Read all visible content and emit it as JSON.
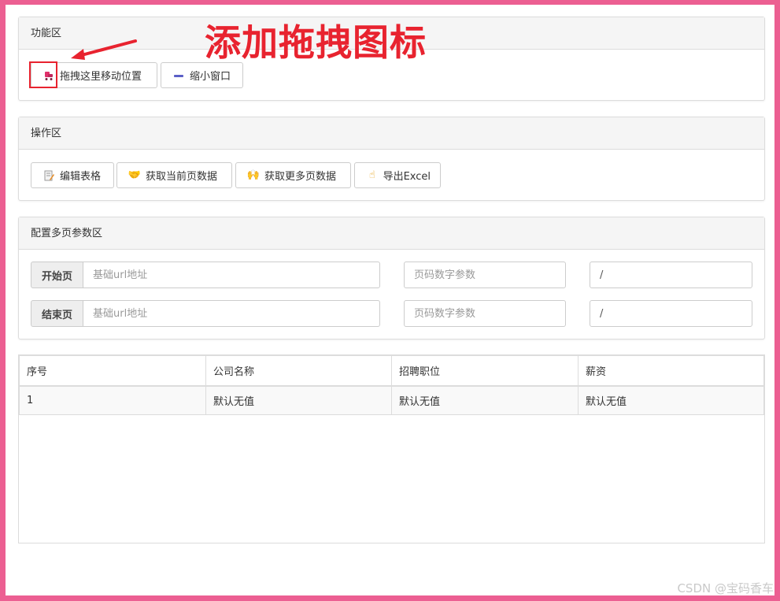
{
  "function_panel": {
    "title": "功能区",
    "drag_button": "拖拽这里移动位置",
    "minimize_button": "缩小窗口"
  },
  "operation_panel": {
    "title": "操作区",
    "buttons": [
      "编辑表格",
      "获取当前页数据",
      "获取更多页数据",
      "导出Excel"
    ]
  },
  "config_panel": {
    "title": "配置多页参数区",
    "start": {
      "label": "开始页",
      "url_placeholder": "基础url地址",
      "page_placeholder": "页码数字参数",
      "suffix_value": "/"
    },
    "end": {
      "label": "结束页",
      "url_placeholder": "基础url地址",
      "page_placeholder": "页码数字参数",
      "suffix_value": "/"
    }
  },
  "table": {
    "headers": [
      "序号",
      "公司名称",
      "招聘职位",
      "薪资"
    ],
    "rows": [
      [
        "1",
        "默认无值",
        "默认无值",
        "默认无值"
      ]
    ]
  },
  "annotation": {
    "title": "添加拖拽图标",
    "color": "#e8232f"
  },
  "watermark": "CSDN @宝码香车",
  "colors": {
    "frame": "#ec5f92",
    "panel_header": "#f5f5f5",
    "border": "#dcdcdc"
  }
}
